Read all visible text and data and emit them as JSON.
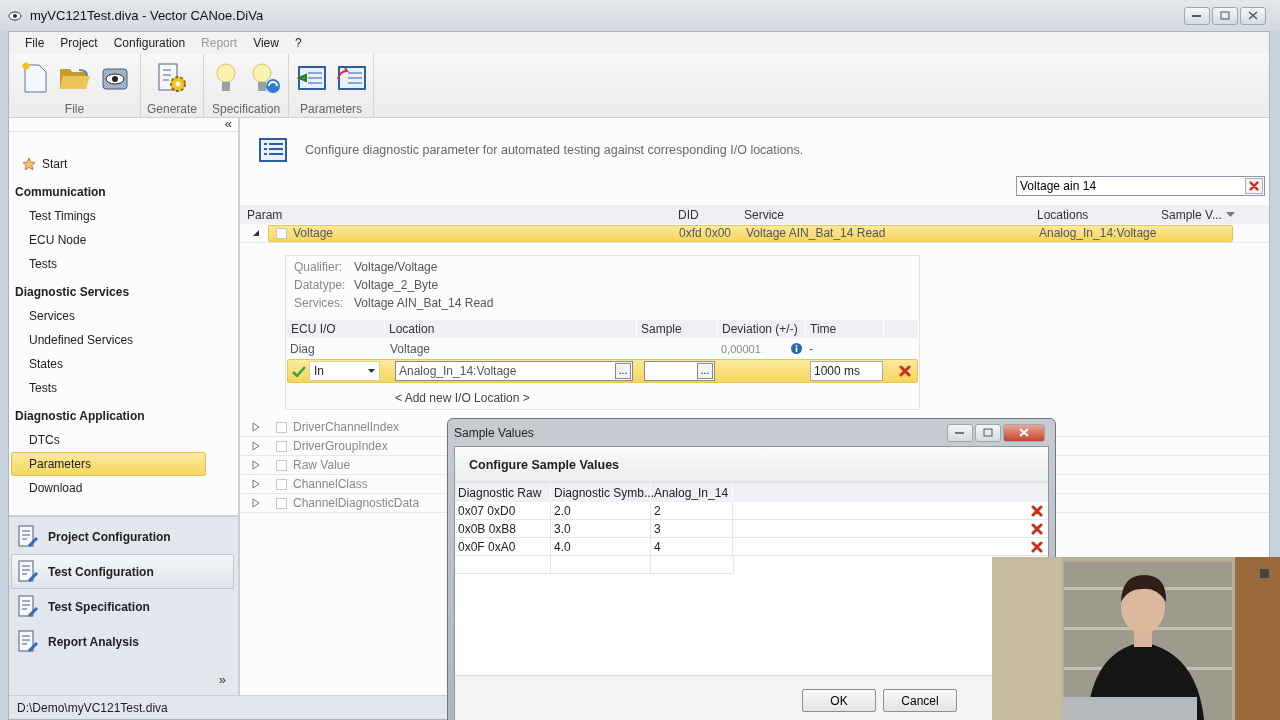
{
  "window": {
    "title": "myVC121Test.diva - Vector CANoe.DiVa"
  },
  "menu": [
    {
      "label": "File",
      "disabled": false
    },
    {
      "label": "Project",
      "disabled": false
    },
    {
      "label": "Configuration",
      "disabled": false
    },
    {
      "label": "Report",
      "disabled": true
    },
    {
      "label": "View",
      "disabled": false
    },
    {
      "label": "?",
      "disabled": false
    }
  ],
  "ribbon": [
    {
      "label": "File",
      "tools": [
        {
          "kind": "new-file"
        },
        {
          "kind": "open-folder"
        },
        {
          "kind": "eye-case"
        }
      ]
    },
    {
      "label": "Generate",
      "tools": [
        {
          "kind": "gear-list"
        }
      ]
    },
    {
      "label": "Specification",
      "tools": [
        {
          "kind": "bulb"
        },
        {
          "kind": "bulb-sync"
        }
      ]
    },
    {
      "label": "Parameters",
      "tools": [
        {
          "kind": "list-import"
        },
        {
          "kind": "list-export"
        }
      ]
    }
  ],
  "sidebar": {
    "collapse": "«",
    "start": {
      "label": "Start",
      "selected": false
    },
    "sections": [
      {
        "title": "Communication",
        "items": [
          {
            "label": "Test Timings",
            "selected": false
          },
          {
            "label": "ECU Node",
            "selected": false
          },
          {
            "label": "Tests",
            "selected": false
          }
        ]
      },
      {
        "title": "Diagnostic Services",
        "items": [
          {
            "label": "Services",
            "selected": false
          },
          {
            "label": "Undefined Services",
            "selected": false
          },
          {
            "label": "States",
            "selected": false
          },
          {
            "label": "Tests",
            "selected": false
          }
        ]
      },
      {
        "title": "Diagnostic Application",
        "items": [
          {
            "label": "DTCs",
            "selected": false
          },
          {
            "label": "Parameters",
            "selected": true
          },
          {
            "label": "Download",
            "selected": false
          }
        ]
      }
    ],
    "modules": [
      {
        "label": "Project Configuration",
        "selected": false
      },
      {
        "label": "Test Configuration",
        "selected": true
      },
      {
        "label": "Test Specification",
        "selected": false
      },
      {
        "label": "Report Analysis",
        "selected": false
      }
    ],
    "more": "»"
  },
  "main": {
    "description": "Configure diagnostic parameter for automated testing against corresponding I/O locations.",
    "search": {
      "value": "Voltage ain 14"
    },
    "columns": [
      "Param",
      "DID",
      "Service",
      "Locations",
      "Sample V..."
    ],
    "rows": [
      {
        "param": "Voltage",
        "did": "0xfd 0x00",
        "service": "Voltage AIN_Bat_14 Read",
        "locations": "Analog_In_14:Voltage",
        "selected": true,
        "expanded": true,
        "checked": false,
        "details": {
          "fields": [
            {
              "label": "Qualifier:",
              "value": "Voltage/Voltage"
            },
            {
              "label": "Datatype:",
              "value": "Voltage_2_Byte"
            },
            {
              "label": "Services:",
              "value": "Voltage AIN_Bat_14 Read"
            }
          ],
          "io_columns": [
            "ECU I/O",
            "Location",
            "Sample",
            "Deviation (+/-)",
            "Time"
          ],
          "diag_row": {
            "io": "Diag",
            "location": "Voltage",
            "deviation": "0,00001",
            "time": "-"
          },
          "edit_row": {
            "valid": true,
            "direction": "In",
            "location": "Analog_In_14:Voltage",
            "browse": "...",
            "sample_browse": "...",
            "time": "1000 ms"
          },
          "add_link": "< Add new I/O Location >"
        }
      },
      {
        "param": "DriverChannelIndex",
        "selected": false,
        "expanded": false,
        "checked": false
      },
      {
        "param": "DriverGroupIndex",
        "selected": false,
        "expanded": false,
        "checked": false
      },
      {
        "param": "Raw Value",
        "selected": false,
        "expanded": false,
        "checked": false
      },
      {
        "param": "ChannelClass",
        "selected": false,
        "expanded": false,
        "checked": false
      },
      {
        "param": "ChannelDiagnosticData",
        "selected": false,
        "expanded": false,
        "checked": false
      }
    ]
  },
  "status_bar": "D:\\Demo\\myVC121Test.diva",
  "dialog": {
    "title": "Sample Values",
    "heading": "Configure Sample Values",
    "columns": [
      "Diagnostic Raw",
      "Diagnostic Symb...",
      "Analog_In_14"
    ],
    "rows": [
      [
        "0x07 0xD0",
        "2.0",
        "2"
      ],
      [
        "0x0B 0xB8",
        "3.0",
        "3"
      ],
      [
        "0x0F 0xA0",
        "4.0",
        "4"
      ]
    ],
    "buttons": [
      {
        "label": "OK"
      },
      {
        "label": "Cancel"
      }
    ]
  }
}
